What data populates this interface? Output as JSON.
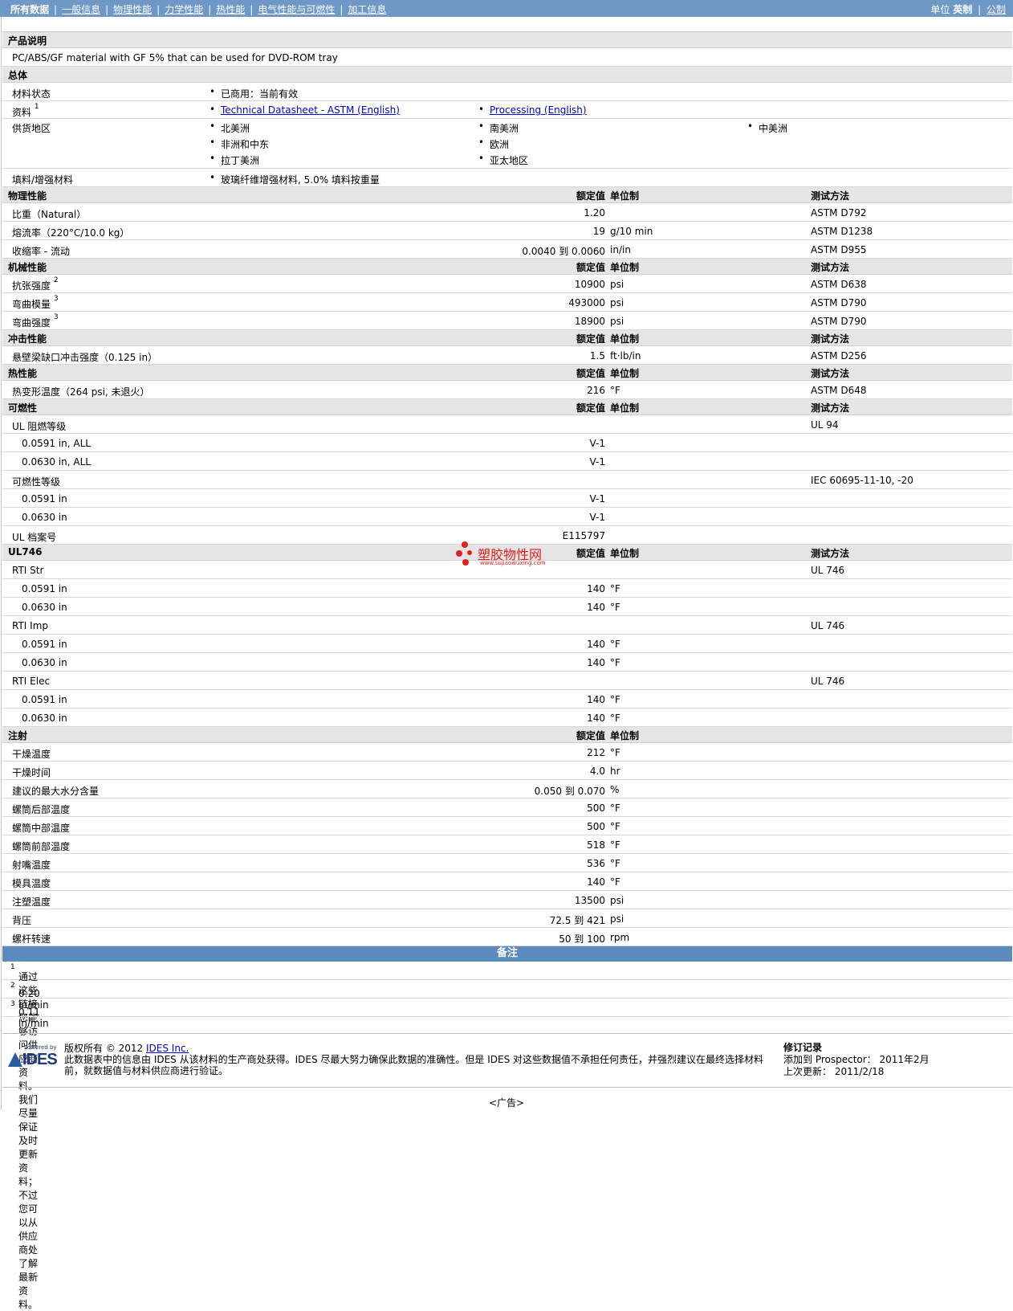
{
  "nav": {
    "current": "所有数据",
    "links": [
      "一般信息",
      "物理性能",
      "力学性能",
      "热性能",
      "电气性能与可燃性",
      "加工信息"
    ],
    "unit_label": "单位",
    "unit_current": "英制",
    "unit_alt": "公制"
  },
  "headers": {
    "value": "额定值",
    "unit": "单位制",
    "method": "测试方法"
  },
  "description": {
    "title": "产品说明",
    "text": "PC/ABS/GF material with GF 5% that can be used for DVD-ROM tray"
  },
  "general": {
    "title": "总体",
    "status_label": "材料状态",
    "status_value": "已商用：当前有效",
    "docs_label": "资料",
    "docs_sup": "1",
    "docs": [
      "Technical Datasheet - ASTM (English)",
      "Processing (English)"
    ],
    "regions_label": "供货地区",
    "regions": [
      "北美洲",
      "南美洲",
      "中美洲",
      "非洲和中东",
      "欧洲",
      "拉丁美洲",
      "亚太地区"
    ],
    "filler_label": "填料/增强材料",
    "filler_value": "玻璃纤维增强材料, 5.0% 填料按重量"
  },
  "physical": {
    "title": "物理性能",
    "rows": [
      {
        "name": "比重（Natural）",
        "value": "1.20",
        "unit": "",
        "method": "ASTM D792"
      },
      {
        "name": "熔流率（220°C/10.0 kg）",
        "value": "19",
        "unit": "g/10 min",
        "method": "ASTM D1238"
      },
      {
        "name": "收缩率 - 流动",
        "value": "0.0040 到  0.0060",
        "unit": "in/in",
        "method": "ASTM D955"
      }
    ]
  },
  "mechanical": {
    "title": "机械性能",
    "rows": [
      {
        "name": "抗张强度",
        "sup": "2",
        "value": "10900",
        "unit": "psi",
        "method": "ASTM D638"
      },
      {
        "name": "弯曲模量",
        "sup": "3",
        "value": "493000",
        "unit": "psi",
        "method": "ASTM D790"
      },
      {
        "name": "弯曲强度",
        "sup": "3",
        "value": "18900",
        "unit": "psi",
        "method": "ASTM D790"
      }
    ]
  },
  "impact": {
    "title": "冲击性能",
    "rows": [
      {
        "name": "悬壁梁缺口冲击强度（0.125 in）",
        "value": "1.5",
        "unit": "ft·lb/in",
        "method": "ASTM D256"
      }
    ]
  },
  "thermal": {
    "title": "热性能",
    "rows": [
      {
        "name": "热变形温度（264 psi, 未退火）",
        "value": "216",
        "unit": "°F",
        "method": "ASTM D648"
      }
    ]
  },
  "flammability": {
    "title": "可燃性",
    "rows": [
      {
        "name": "UL 阻燃等级",
        "value": "",
        "unit": "",
        "method": "UL 94",
        "sub": false
      },
      {
        "name": "0.0591 in, ALL",
        "value": "V-1",
        "unit": "",
        "method": "",
        "sub": true
      },
      {
        "name": "0.0630 in, ALL",
        "value": "V-1",
        "unit": "",
        "method": "",
        "sub": true
      },
      {
        "name": "可燃性等级",
        "value": "",
        "unit": "",
        "method": "IEC 60695-11-10, -20",
        "sub": false
      },
      {
        "name": "0.0591 in",
        "value": "V-1",
        "unit": "",
        "method": "",
        "sub": true
      },
      {
        "name": "0.0630 in",
        "value": "V-1",
        "unit": "",
        "method": "",
        "sub": true
      },
      {
        "name": "UL 档案号",
        "value": "E115797",
        "unit": "",
        "method": "",
        "sub": false
      }
    ]
  },
  "ul746": {
    "title": "UL746",
    "rows": [
      {
        "name": "RTI Str",
        "value": "",
        "unit": "",
        "method": "UL 746",
        "sub": false
      },
      {
        "name": "0.0591 in",
        "value": "140",
        "unit": "°F",
        "method": "",
        "sub": true
      },
      {
        "name": "0.0630 in",
        "value": "140",
        "unit": "°F",
        "method": "",
        "sub": true
      },
      {
        "name": "RTI Imp",
        "value": "",
        "unit": "",
        "method": "UL 746",
        "sub": false
      },
      {
        "name": "0.0591 in",
        "value": "140",
        "unit": "°F",
        "method": "",
        "sub": true
      },
      {
        "name": "0.0630 in",
        "value": "140",
        "unit": "°F",
        "method": "",
        "sub": true
      },
      {
        "name": "RTI Elec",
        "value": "",
        "unit": "",
        "method": "UL 746",
        "sub": false
      },
      {
        "name": "0.0591 in",
        "value": "140",
        "unit": "°F",
        "method": "",
        "sub": true
      },
      {
        "name": "0.0630 in",
        "value": "140",
        "unit": "°F",
        "method": "",
        "sub": true
      }
    ]
  },
  "injection": {
    "title": "注射",
    "rows": [
      {
        "name": "干燥温度",
        "value": "212",
        "unit": "°F"
      },
      {
        "name": "干燥时间",
        "value": "4.0",
        "unit": "hr"
      },
      {
        "name": "建议的最大水分含量",
        "value": "0.050 到  0.070",
        "unit": "%"
      },
      {
        "name": "螺筒后部温度",
        "value": "500",
        "unit": "°F"
      },
      {
        "name": "螺筒中部温度",
        "value": "500",
        "unit": "°F"
      },
      {
        "name": "螺筒前部温度",
        "value": "518",
        "unit": "°F"
      },
      {
        "name": "射嘴温度",
        "value": "536",
        "unit": "°F"
      },
      {
        "name": "模具温度",
        "value": "140",
        "unit": "°F"
      },
      {
        "name": "注塑温度",
        "value": "13500",
        "unit": "psi"
      },
      {
        "name": "背压",
        "value": "72.5 到  421",
        "unit": "psi"
      },
      {
        "name": "螺杆转速",
        "value": "50 到  100",
        "unit": "rpm"
      }
    ]
  },
  "notes": {
    "title": "备注",
    "items": [
      {
        "sup": "1",
        "text": "通过这些链接您能够访问供应商资料。我们尽量保证及时更新资料；不过您可以从供应商处了解最新资料。"
      },
      {
        "sup": "2",
        "text": "0.20 in/min"
      },
      {
        "sup": "3",
        "text": "0.11 in/min"
      }
    ]
  },
  "footer": {
    "logo_small": "Powered by",
    "logo_text": "IDES",
    "copyright": "版权所有 © 2012",
    "company_link": "IDES Inc.",
    "disclaimer": "此数据表中的信息由 IDES 从该材料的生产商处获得。IDES 尽最大努力确保此数据的准确性。但是 IDES 对这些数据值不承担任何责任，并强烈建议在最终选择材料前，就数据值与材料供应商进行验证。",
    "rev_title": "修订记录",
    "rev_added": "添加到 Prospector： 2011年2月",
    "rev_updated": "上次更新： 2011/2/18"
  },
  "watermark": {
    "title": "塑胶物性网",
    "url": "www.sujiaowuxing.com"
  },
  "ad": "<广告>"
}
